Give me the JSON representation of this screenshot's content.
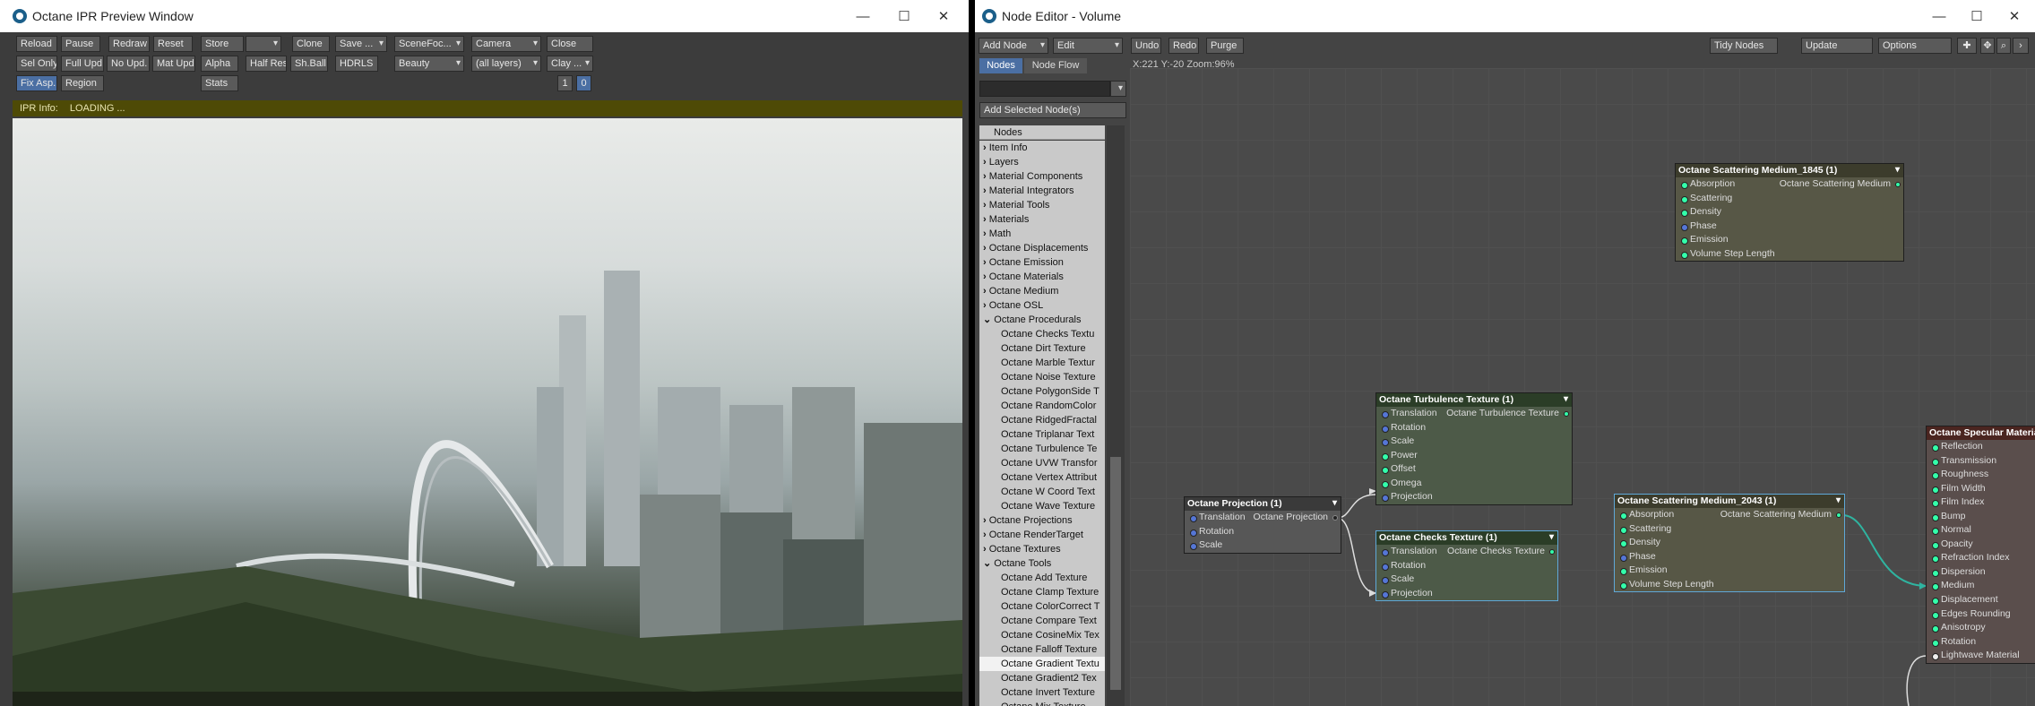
{
  "ipr": {
    "title": "Octane IPR Preview Window",
    "toolbar": {
      "row1": [
        "Reload",
        "Pause",
        "Redraw",
        "Reset",
        "Store",
        "",
        "Clone",
        "Save ...",
        "SceneFoc...",
        "Camera",
        "Close"
      ],
      "row2": [
        "Sel Only",
        "Full Upd.",
        "No Upd.",
        "Mat Upd",
        "Alpha",
        "Half Res",
        "Sh.Ball",
        "HDRLS",
        "Beauty",
        "(all layers)",
        "Clay ..."
      ],
      "row3_left": [
        "Fix Asp.",
        "Region"
      ],
      "stats": "Stats",
      "num1": "1",
      "num2": "0"
    },
    "info_label": "IPR Info:",
    "info_value": "LOADING ..."
  },
  "node_editor": {
    "title": "Node Editor - Volume",
    "menu": {
      "add_node": "Add Node",
      "edit": "Edit",
      "undo": "Undo",
      "redo": "Redo",
      "purge": "Purge",
      "tidy": "Tidy Nodes",
      "update": "Update",
      "options": "Options"
    },
    "tabs": [
      "Nodes",
      "Node Flow"
    ],
    "add_selected": "Add Selected Node(s)",
    "coords": "X:221 Y:-20 Zoom:96%",
    "tree_header": "Nodes",
    "tree_items": [
      {
        "label": "Item Info",
        "type": "folder"
      },
      {
        "label": "Layers",
        "type": "folder"
      },
      {
        "label": "Material Components",
        "type": "folder"
      },
      {
        "label": "Material Integrators",
        "type": "folder"
      },
      {
        "label": "Material Tools",
        "type": "folder"
      },
      {
        "label": "Materials",
        "type": "folder"
      },
      {
        "label": "Math",
        "type": "folder"
      },
      {
        "label": "Octane Displacements",
        "type": "folder"
      },
      {
        "label": "Octane Emission",
        "type": "folder"
      },
      {
        "label": "Octane Materials",
        "type": "folder"
      },
      {
        "label": "Octane Medium",
        "type": "folder"
      },
      {
        "label": "Octane OSL",
        "type": "folder"
      },
      {
        "label": "Octane Procedurals",
        "type": "open"
      },
      {
        "label": "Octane Checks Textu",
        "type": "child"
      },
      {
        "label": "Octane Dirt Texture",
        "type": "child"
      },
      {
        "label": "Octane Marble Textur",
        "type": "child"
      },
      {
        "label": "Octane Noise Texture",
        "type": "child"
      },
      {
        "label": "Octane PolygonSide T",
        "type": "child"
      },
      {
        "label": "Octane RandomColor",
        "type": "child"
      },
      {
        "label": "Octane RidgedFractal",
        "type": "child"
      },
      {
        "label": "Octane Triplanar Text",
        "type": "child"
      },
      {
        "label": "Octane Turbulence Te",
        "type": "child"
      },
      {
        "label": "Octane UVW Transfor",
        "type": "child"
      },
      {
        "label": "Octane Vertex Attribut",
        "type": "child"
      },
      {
        "label": "Octane W Coord Text",
        "type": "child"
      },
      {
        "label": "Octane Wave Texture",
        "type": "child"
      },
      {
        "label": "Octane Projections",
        "type": "folder"
      },
      {
        "label": "Octane RenderTarget",
        "type": "folder"
      },
      {
        "label": "Octane Textures",
        "type": "folder"
      },
      {
        "label": "Octane Tools",
        "type": "open"
      },
      {
        "label": "Octane Add Texture",
        "type": "child"
      },
      {
        "label": "Octane Clamp Texture",
        "type": "child"
      },
      {
        "label": "Octane ColorCorrect T",
        "type": "child"
      },
      {
        "label": "Octane Compare Text",
        "type": "child"
      },
      {
        "label": "Octane CosineMix Tex",
        "type": "child"
      },
      {
        "label": "Octane Falloff Texture",
        "type": "child"
      },
      {
        "label": "Octane Gradient Textu",
        "type": "child-selected"
      },
      {
        "label": "Octane Gradient2 Tex",
        "type": "child"
      },
      {
        "label": "Octane Invert Texture",
        "type": "child"
      },
      {
        "label": "Octane Mix Texture",
        "type": "child"
      }
    ],
    "nodes": {
      "scatter1845": {
        "title": "Octane Scattering Medium_1845 (1)",
        "output": "Octane Scattering Medium",
        "inputs": [
          "Absorption",
          "Scattering",
          "Density",
          "Phase",
          "Emission",
          "Volume Step Length"
        ]
      },
      "turbulence": {
        "title": "Octane Turbulence Texture (1)",
        "output": "Octane Turbulence Texture",
        "inputs": [
          "Translation",
          "Rotation",
          "Scale",
          "Power",
          "Offset",
          "Omega",
          "Projection"
        ]
      },
      "projection": {
        "title": "Octane Projection (1)",
        "output": "Octane Projection",
        "inputs": [
          "Translation",
          "Rotation",
          "Scale"
        ]
      },
      "checks": {
        "title": "Octane Checks Texture (1)",
        "output": "Octane Checks Texture",
        "inputs": [
          "Translation",
          "Rotation",
          "Scale",
          "Projection"
        ]
      },
      "scatter2043": {
        "title": "Octane Scattering Medium_2043 (1)",
        "output": "Octane Scattering Medium",
        "inputs": [
          "Absorption",
          "Scattering",
          "Density",
          "Phase",
          "Emission",
          "Volume Step Length"
        ]
      },
      "specular": {
        "title": "Octane Specular Material",
        "inputs": [
          "Reflection",
          "Transmission",
          "Roughness",
          "Film Width",
          "Film Index",
          "Bump",
          "Normal",
          "Opacity",
          "Refraction Index",
          "Dispersion",
          "Medium",
          "Displacement",
          "Edges Rounding",
          "Anisotropy",
          "Rotation",
          "Lightwave Material"
        ]
      }
    }
  }
}
